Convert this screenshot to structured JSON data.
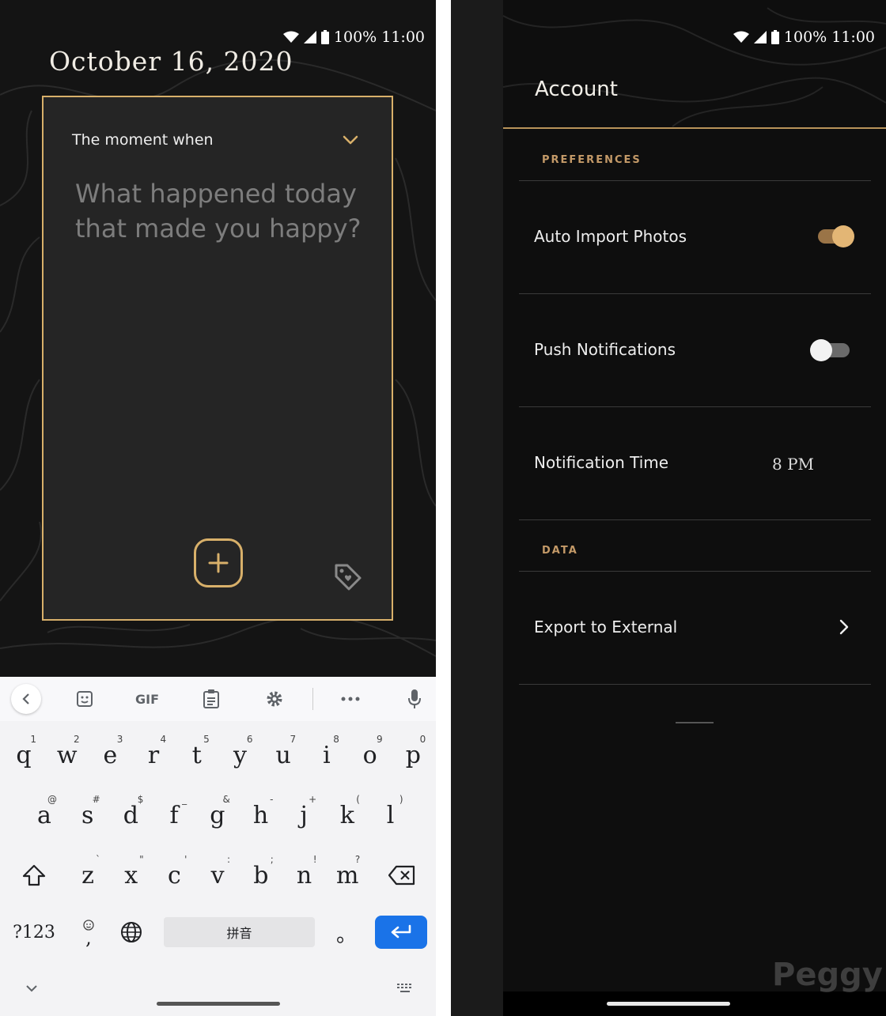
{
  "status_bar": {
    "battery": "100%",
    "time": "11:00"
  },
  "journal": {
    "date": "October 16, 2020",
    "prompt_label": "The moment when",
    "placeholder": "What happened today that made you happy?",
    "accent_color": "#d8b06a"
  },
  "keyboard": {
    "toolbar": {
      "gif_label": "GIF"
    },
    "rows": [
      [
        {
          "key": "q",
          "hint": "1"
        },
        {
          "key": "w",
          "hint": "2"
        },
        {
          "key": "e",
          "hint": "3"
        },
        {
          "key": "r",
          "hint": "4"
        },
        {
          "key": "t",
          "hint": "5"
        },
        {
          "key": "y",
          "hint": "6"
        },
        {
          "key": "u",
          "hint": "7"
        },
        {
          "key": "i",
          "hint": "8"
        },
        {
          "key": "o",
          "hint": "9"
        },
        {
          "key": "p",
          "hint": "0"
        }
      ],
      [
        {
          "key": "a",
          "hint": "@"
        },
        {
          "key": "s",
          "hint": "#"
        },
        {
          "key": "d",
          "hint": "$"
        },
        {
          "key": "f",
          "hint": "_"
        },
        {
          "key": "g",
          "hint": "&"
        },
        {
          "key": "h",
          "hint": "-"
        },
        {
          "key": "j",
          "hint": "+"
        },
        {
          "key": "k",
          "hint": "("
        },
        {
          "key": "l",
          "hint": ")"
        }
      ],
      [
        {
          "key": "z",
          "hint": "`"
        },
        {
          "key": "x",
          "hint": "\""
        },
        {
          "key": "c",
          "hint": "'"
        },
        {
          "key": "v",
          "hint": ":"
        },
        {
          "key": "b",
          "hint": ";"
        },
        {
          "key": "n",
          "hint": "!"
        },
        {
          "key": "m",
          "hint": "?"
        }
      ]
    ],
    "symbols_label": "?123",
    "comma_label": ",",
    "space_label": "拼音",
    "period_label": "。",
    "enter_color": "#1a73e8"
  },
  "account": {
    "title": "Account",
    "preferences_label": "PREFERENCES",
    "data_label": "DATA",
    "rows": {
      "auto_import": {
        "label": "Auto Import Photos",
        "enabled": true
      },
      "push": {
        "label": "Push Notifications",
        "enabled": false
      },
      "notif_time": {
        "label": "Notification Time",
        "value": "8 PM"
      },
      "export": {
        "label": "Export to External"
      }
    },
    "section_color": "#c49a68"
  },
  "watermark": "Peggy"
}
